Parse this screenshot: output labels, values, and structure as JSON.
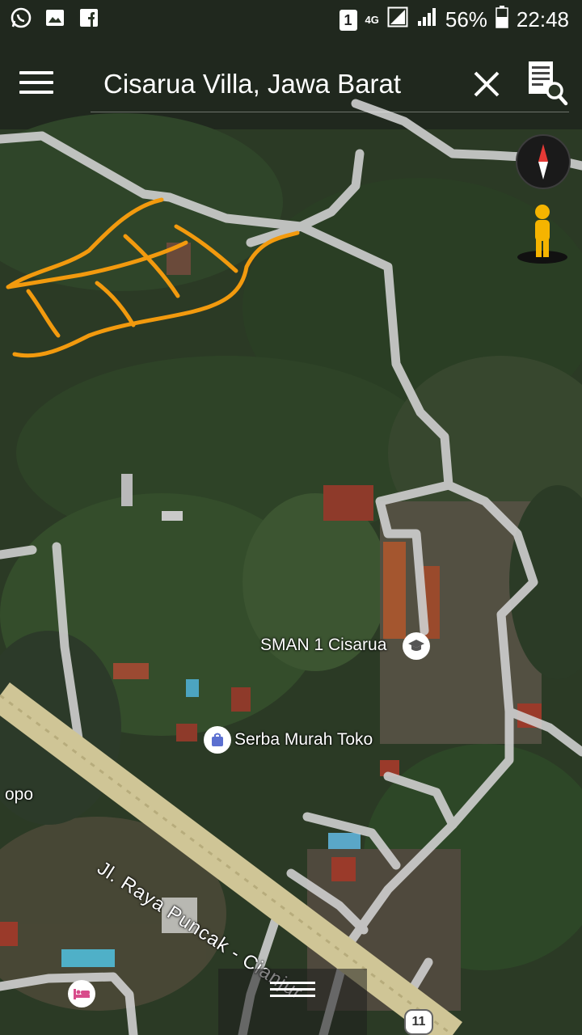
{
  "status_bar": {
    "sim_slot": "1",
    "network": "4G",
    "battery": "56%",
    "time": "22:48",
    "left_icons": [
      "whatsapp-icon",
      "gallery-icon",
      "facebook-icon"
    ]
  },
  "search": {
    "query": "Cisarua Villa, Jawa Barat"
  },
  "map_labels": {
    "school": "SMAN 1 Cisarua",
    "shop": "Serba Murah Toko",
    "road": "Jl. Raya Puncak - Cianjur",
    "edge_place": "opo",
    "route_number": "11"
  },
  "colors": {
    "drawing_stroke": "#f29a0e",
    "road": "#cfcfcf",
    "main_road": "#d8cfa7"
  }
}
